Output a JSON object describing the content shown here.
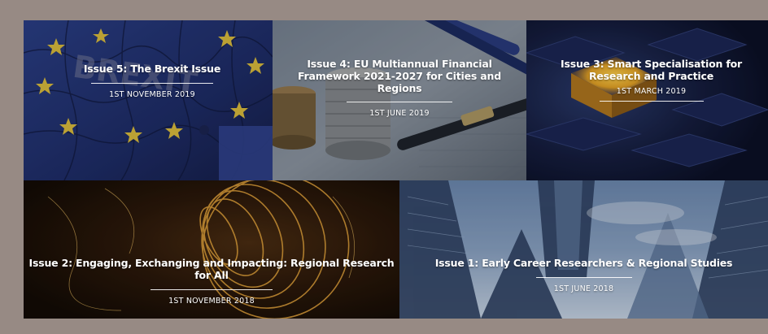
{
  "issues": [
    {
      "title": "Issue 5: The Brexit Issue",
      "date": "1ST NOVEMBER 2019",
      "image_icon": "brexit-puzzle-image"
    },
    {
      "title": "Issue 4: EU Multiannual Financial Framework 2021-2027 for Cities and Regions",
      "date": "1ST JUNE 2019",
      "image_icon": "coins-and-pens-image"
    },
    {
      "title": "Issue 3: Smart Specialisation for Research and Practice",
      "date": "1ST MARCH 2019",
      "image_icon": "glowing-cubes-image"
    },
    {
      "title": "Issue 2: Engaging, Exchanging and Impacting: Regional Research for All",
      "date": "1ST NOVEMBER 2018",
      "image_icon": "light-spirals-image"
    },
    {
      "title": "Issue 1: Early Career Researchers & Regional Studies",
      "date": "1ST JUNE 2018",
      "image_icon": "skyscrapers-image"
    }
  ],
  "colors": {
    "frame": "#978a84",
    "caption_text": "#ffffff"
  }
}
